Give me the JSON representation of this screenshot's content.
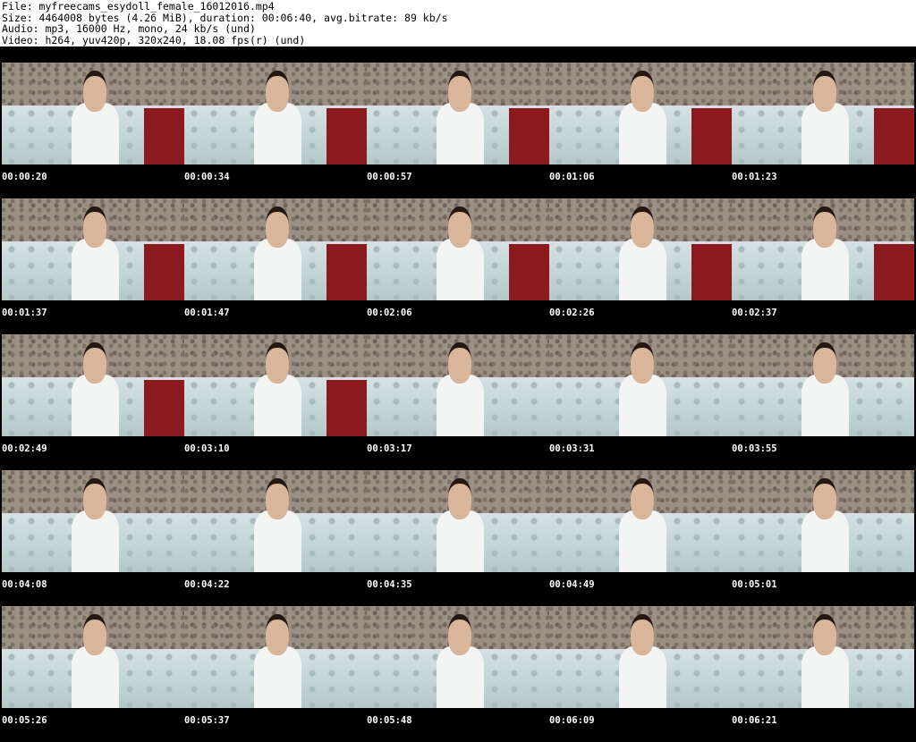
{
  "header": {
    "file": "File: myfreecams_esydoll_female_16012016.mp4",
    "size": "Size: 4464008 bytes (4.26 MiB), duration: 00:06:40, avg.bitrate: 89 kb/s",
    "audio": "Audio: mp3, 16000 Hz, mono, 24 kb/s (und)",
    "video": "Video: h264, yuv420p, 320x240, 18.08 fps(r) (und)"
  },
  "thumbnails": [
    [
      "00:00:20",
      "00:00:34",
      "00:00:57",
      "00:01:06",
      "00:01:23"
    ],
    [
      "00:01:37",
      "00:01:47",
      "00:02:06",
      "00:02:26",
      "00:02:37"
    ],
    [
      "00:02:49",
      "00:03:10",
      "00:03:17",
      "00:03:31",
      "00:03:55"
    ],
    [
      "00:04:08",
      "00:04:22",
      "00:04:35",
      "00:04:49",
      "00:05:01"
    ],
    [
      "00:05:26",
      "00:05:37",
      "00:05:48",
      "00:06:09",
      "00:06:21"
    ]
  ]
}
